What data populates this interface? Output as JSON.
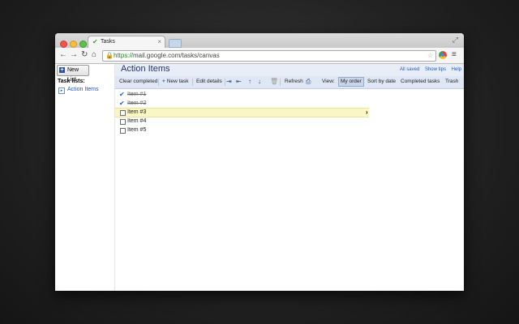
{
  "browser": {
    "tab_title": "Tasks",
    "url_secure": "https://",
    "url_host": "mail.google.com",
    "url_path": "/tasks/canvas"
  },
  "sidebar": {
    "new_list_label": "New List",
    "task_lists_heading": "Task lists:",
    "lists": [
      {
        "label": "Action Items"
      }
    ]
  },
  "main": {
    "title": "Action Items",
    "status": "All saved",
    "show_tips": "Show tips",
    "help": "Help"
  },
  "actions": {
    "clear_completed": "Clear completed",
    "new_task": "New task",
    "edit_details": "Edit details",
    "refresh": "Refresh",
    "view_label": "View:",
    "my_order": "My order",
    "sort_by_date": "Sort by date",
    "completed_tasks": "Completed tasks",
    "trash": "Trash"
  },
  "tasks": [
    {
      "text": "Item #1",
      "done": true
    },
    {
      "text": "Item #2",
      "done": true
    },
    {
      "text": "Item #3",
      "done": false,
      "selected": true
    },
    {
      "text": "Item #4",
      "done": false
    },
    {
      "text": "Item #5",
      "done": false
    }
  ],
  "colors": {
    "accent": "#2156b7",
    "selected_row": "#fbf7c4",
    "toolbar_bg": "#dfe7f5"
  }
}
